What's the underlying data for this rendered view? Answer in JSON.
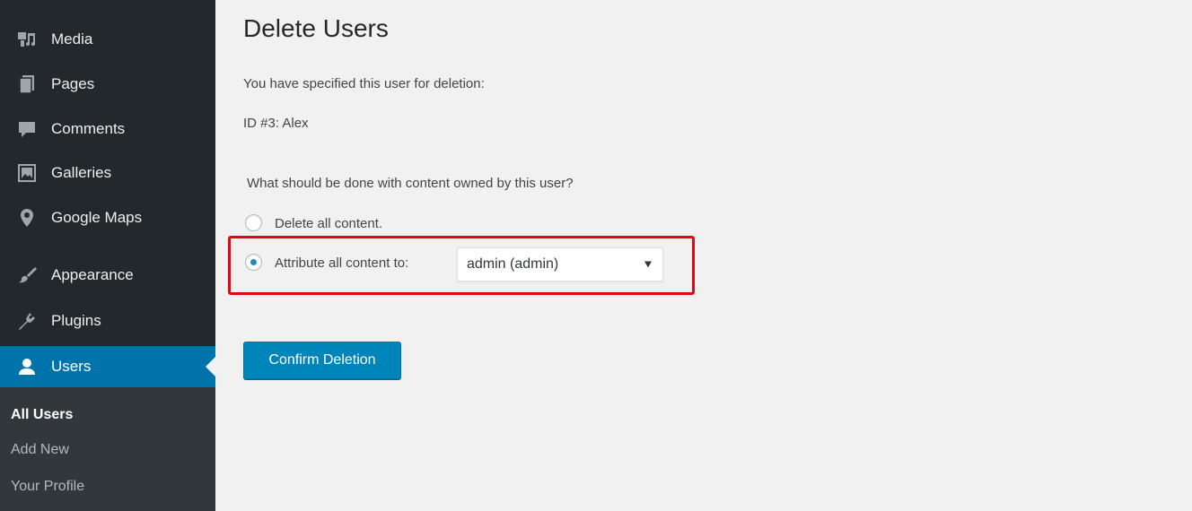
{
  "sidebar": {
    "items": [
      {
        "label": "Media",
        "icon": "media-icon"
      },
      {
        "label": "Pages",
        "icon": "pages-icon"
      },
      {
        "label": "Comments",
        "icon": "comments-icon"
      },
      {
        "label": "Galleries",
        "icon": "galleries-icon"
      },
      {
        "label": "Google Maps",
        "icon": "map-pin-icon"
      },
      {
        "label": "Appearance",
        "icon": "paintbrush-icon"
      },
      {
        "label": "Plugins",
        "icon": "plugin-icon"
      },
      {
        "label": "Users",
        "icon": "user-icon",
        "active": true
      }
    ],
    "submenu": [
      {
        "label": "All Users",
        "current": true
      },
      {
        "label": "Add New"
      },
      {
        "label": "Your Profile"
      }
    ]
  },
  "main": {
    "title": "Delete Users",
    "intro": "You have specified this user for deletion:",
    "user_line": "ID #3: Alex",
    "question": "What should be done with content owned by this user?",
    "option_delete": "Delete all content.",
    "option_attribute": "Attribute all content to:",
    "attribute_select_value": "admin (admin)",
    "selected_option": "attribute",
    "confirm_button": "Confirm Deletion"
  },
  "colors": {
    "sidebar_bg": "#23282d",
    "submenu_bg": "#32373c",
    "active_bg": "#0073aa",
    "button_bg": "#0085ba",
    "highlight": "#e30613",
    "page_bg": "#f1f1f1"
  }
}
